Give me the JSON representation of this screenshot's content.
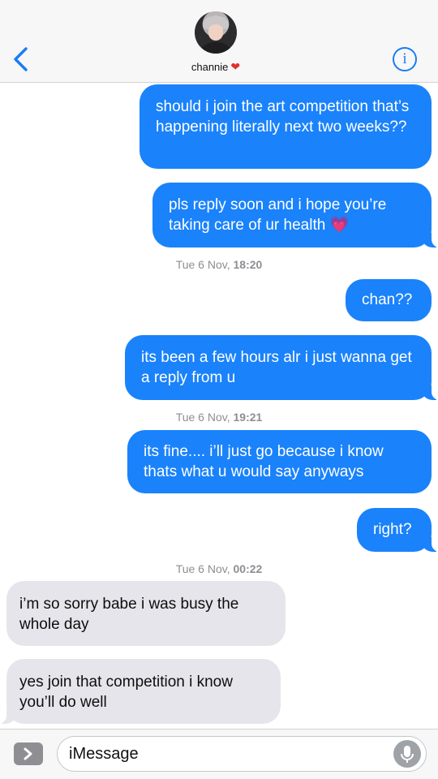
{
  "header": {
    "contact_name": "channie",
    "contact_emoji": "❤",
    "back_icon": "chevron-left-icon",
    "info_icon": "info-icon",
    "info_glyph": "i",
    "accent_color": "#1a7cf5"
  },
  "messages": [
    {
      "id": "m1",
      "direction": "sent",
      "text": "should i join the art competition that’s happening literally next two weeks??"
    },
    {
      "id": "m2",
      "direction": "sent",
      "text": "pls reply soon and i hope you’re taking care of ur health",
      "emoji": "💗"
    },
    {
      "id": "m3",
      "direction": "sent",
      "text": "chan??"
    },
    {
      "id": "m4",
      "direction": "sent",
      "text": "its been a few hours alr i just wanna get a reply from u"
    },
    {
      "id": "m5",
      "direction": "sent",
      "text": "its fine.... i’ll just go because i know thats what u would say anyways"
    },
    {
      "id": "m6",
      "direction": "sent",
      "text": "right?"
    },
    {
      "id": "m7",
      "direction": "received",
      "text": "i’m so sorry babe i was busy the whole day"
    },
    {
      "id": "m8",
      "direction": "received",
      "text": "yes join that competition i know you’ll do well"
    }
  ],
  "timestamps": [
    {
      "day": "Tue 6 Nov,",
      "time": "18:20"
    },
    {
      "day": "Tue 6 Nov,",
      "time": "19:21"
    },
    {
      "day": "Tue 6 Nov,",
      "time": "00:22"
    }
  ],
  "input_bar": {
    "placeholder": "iMessage",
    "apps_icon": "app-store-icon",
    "mic_icon": "microphone-icon"
  },
  "colors": {
    "sent_bubble": "#1a82fb",
    "received_bubble": "#e6e5eb",
    "timestamp": "#8e8e93"
  }
}
